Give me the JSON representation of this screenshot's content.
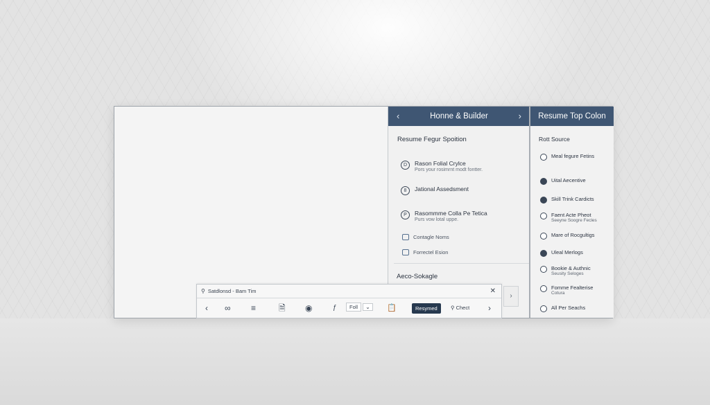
{
  "panel": {
    "title": "Honne & Builder",
    "prev_icon": "chevron-left-icon",
    "next_icon": "chevron-right-icon",
    "section_title": "Resume Fegur Spoition",
    "items": [
      {
        "title": "Rason Folial Crylce",
        "subtitle": "Pors your rosimrnt modt fontter."
      },
      {
        "title": "Jational Assedsment",
        "subtitle": ""
      },
      {
        "title": "Rasommme Colla Pe Tetica",
        "subtitle": "Purs vow lotal uppe."
      }
    ],
    "small_items": [
      {
        "label": "Contagle Noms",
        "icon": "lock-icon"
      },
      {
        "label": "Forrectel Esion",
        "icon": "calendar-icon"
      }
    ],
    "auto_title": "Aeco-Sokagle"
  },
  "right": {
    "title": "Resume Top Colon",
    "section": "Rott Source",
    "items": [
      {
        "title": "Meal fegure Fetins",
        "subtitle": ""
      },
      {
        "title": "Uital Aecentive",
        "subtitle": ""
      },
      {
        "title": "Skill Trink Cardicts",
        "subtitle": ""
      },
      {
        "title": "Faent Acte Pheot",
        "subtitle": "Seeyne Soogre Fecles"
      },
      {
        "title": "Mare of Rocgultigs",
        "subtitle": ""
      },
      {
        "title": "Uleal Merlogs",
        "subtitle": ""
      },
      {
        "title": "Bookie & Authnic",
        "subtitle": "Seusity Seloges"
      },
      {
        "title": "Fomme Fealterise",
        "subtitle": "Cotura"
      },
      {
        "title": "All Per Seachs",
        "subtitle": ""
      }
    ]
  },
  "toolbar": {
    "search_value": "Satdlonsd - Bam Tim",
    "search_icon": "search-icon",
    "close_icon": "close-icon",
    "back_icon": "chevron-left-icon",
    "font_value": "Foll",
    "primary_label": "Resymed",
    "check_label": "Chect",
    "next_icon": "chevron-right-icon"
  },
  "colors": {
    "header": "#3f5673",
    "primary": "#27394f",
    "border": "#9ea4ab"
  }
}
